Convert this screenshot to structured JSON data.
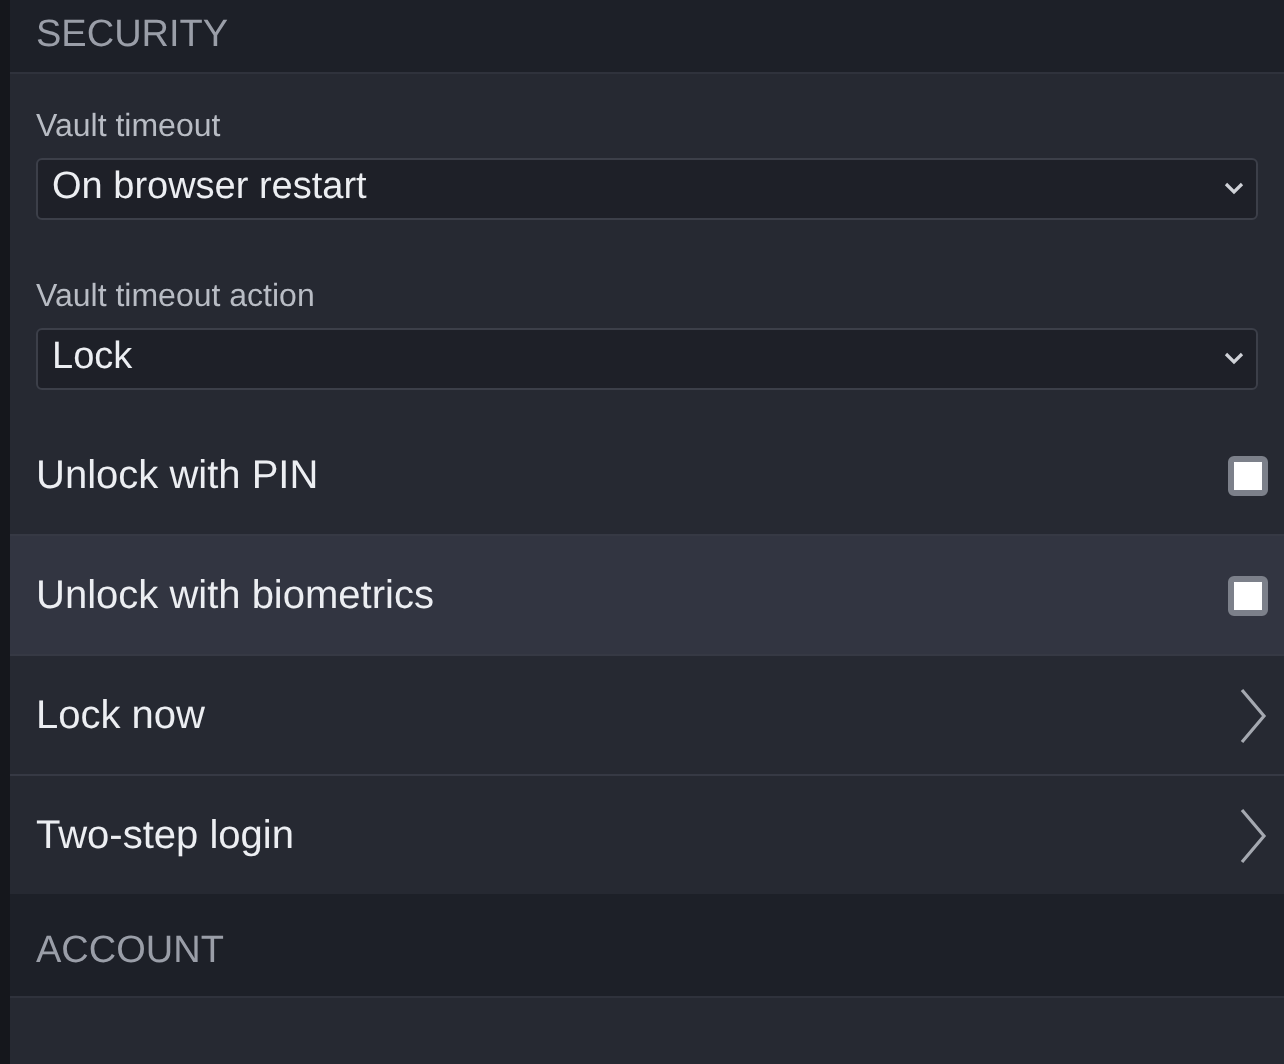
{
  "sections": [
    {
      "title": "SECURITY",
      "selects": [
        {
          "label": "Vault timeout",
          "value": "On browser restart"
        },
        {
          "label": "Vault timeout action",
          "value": "Lock"
        }
      ],
      "rows": [
        {
          "kind": "checkbox",
          "label": "Unlock with PIN",
          "checked": false,
          "highlighted": false
        },
        {
          "kind": "checkbox",
          "label": "Unlock with biometrics",
          "checked": false,
          "highlighted": true
        },
        {
          "kind": "link",
          "label": "Lock now",
          "highlighted": false
        },
        {
          "kind": "link",
          "label": "Two-step login",
          "highlighted": false
        }
      ]
    },
    {
      "title": "ACCOUNT"
    }
  ]
}
